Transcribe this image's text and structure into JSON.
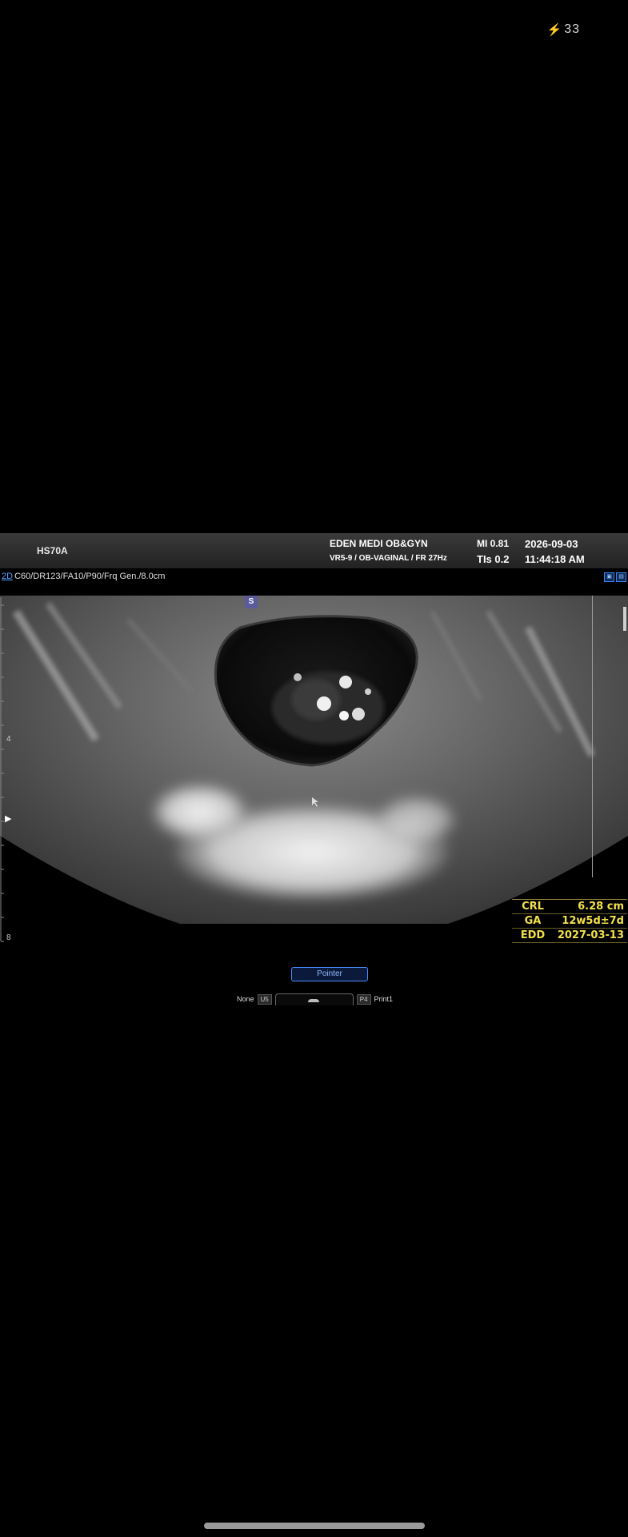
{
  "status_bar": {
    "battery_icon": "charging-bolt-icon",
    "battery_glyph": "⚡",
    "battery_level": "33"
  },
  "ultrasound": {
    "header": {
      "device_model": "HS70A",
      "clinic_name": "EDEN MEDI OB&GYN",
      "probe_info": "VR5-9 / OB-VAGINAL / FR 27Hz",
      "mi": "MI  0.81",
      "tis": "TIs 0.2",
      "date": "2026-09-03",
      "time": "11:44:18 AM"
    },
    "params": {
      "mode": "2D",
      "settings": "C60/DR123/FA10/P90/Frq Gen./8.0cm"
    },
    "orientation_marker": "S",
    "depth_labels": {
      "mid": "4",
      "bottom": "8"
    },
    "focus_marker": "▶",
    "measurements": [
      {
        "label": "CRL",
        "value": "6.28 cm"
      },
      {
        "label": "GA",
        "value": "12w5d±7d"
      },
      {
        "label": "EDD",
        "value": "2027-03-13"
      }
    ],
    "pointer_button": "Pointer",
    "bottom_controls": {
      "left_label": "None",
      "left_key": "U5",
      "right_key": "P4",
      "right_label": "Print1"
    }
  }
}
